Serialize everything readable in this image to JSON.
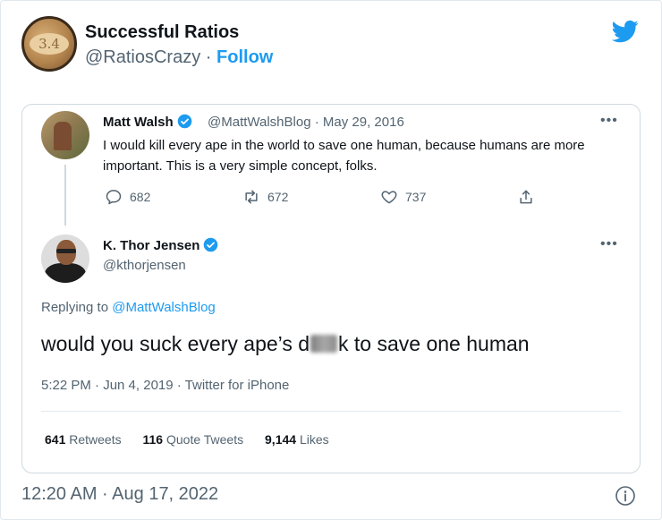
{
  "header": {
    "avatar_text": "3.4",
    "name": "Successful Ratios",
    "handle": "@RatiosCrazy",
    "separator": "·",
    "follow_label": "Follow"
  },
  "quoted_tweet": {
    "author_name": "Matt Walsh",
    "handle": "@MattWalshBlog",
    "date": "May 29, 2016",
    "text": "I would kill every ape in the world to save one human, because humans are more important. This is a very simple concept, folks.",
    "reply_count": "682",
    "retweet_count": "672",
    "like_count": "737"
  },
  "reply_tweet": {
    "author_name": "K. Thor Jensen",
    "handle": "@kthorjensen",
    "replying_prefix": "Replying to",
    "replying_to": "@MattWalshBlog",
    "text_before": "would you suck every ape’s d",
    "text_after": "k to save one human",
    "timestamp": "5:22 PM · Jun 4, 2019 · Twitter for iPhone",
    "retweets_count": "641",
    "retweets_label": "Retweets",
    "quote_count": "116",
    "quote_label": "Quote Tweets",
    "likes_count": "9,144",
    "likes_label": "Likes"
  },
  "footer": {
    "timestamp": "12:20 AM · Aug 17, 2022"
  },
  "colors": {
    "accent": "#1d9bf0",
    "text": "#0f1419",
    "secondary": "#536471"
  }
}
